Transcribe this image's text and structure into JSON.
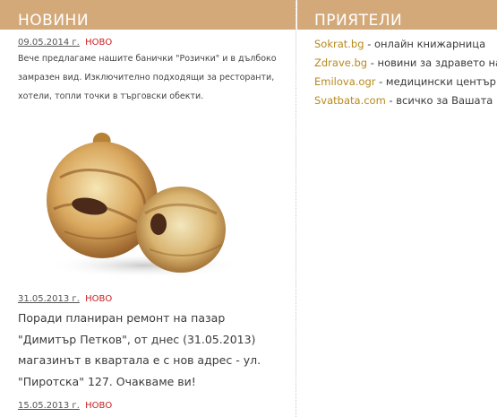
{
  "news": {
    "header": "НОВИНИ",
    "new_label": "НОВО",
    "items": [
      {
        "date": "09.05.2014 г.",
        "text": "Вече предлагаме нашите банички \"Розички\" и в дълбоко замразен вид. Изключително подходящи за ресторанти, хотели, топли точки в търговски обекти."
      },
      {
        "date": "31.05.2013 г.",
        "text": "Поради планиран ремонт на пазар \"Димитър Петков\", от днес (31.05.2013) магазинът в квартала е с нов адрес - ул. \"Пиротска\" 127. Очакваме ви!"
      },
      {
        "date": "15.05.2013 г.",
        "text": ""
      }
    ],
    "image_label": "rozichki-pastry"
  },
  "friends": {
    "header": "ПРИЯТЕЛИ",
    "items": [
      {
        "link": "Sokrat.bg",
        "desc": " - онлайн книжарница"
      },
      {
        "link": "Zdrave.bg",
        "desc": " - новини за здравето на"
      },
      {
        "link": "Emilova.ogr",
        "desc": " - медицински център д"
      },
      {
        "link": "Svatbata.com",
        "desc": " -  всичко за Вашата"
      }
    ]
  },
  "colors": {
    "header_bg": "#d4a97a",
    "new_badge": "#cc1d1d",
    "friend_link": "#b8891c"
  }
}
